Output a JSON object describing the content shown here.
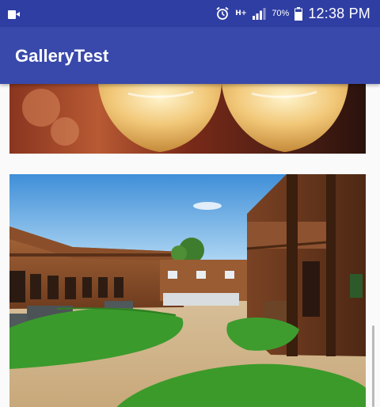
{
  "status_bar": {
    "left_icon": "video-camera-icon",
    "alarm_icon": "alarm-clock-icon",
    "network_label": "H+",
    "signal_icon": "cell-signal-icon",
    "battery_percent": "70%",
    "battery_icon": "battery-charging-icon",
    "time": "12:38 PM"
  },
  "app_bar": {
    "title": "GalleryTest",
    "color": "#3949ab"
  },
  "gallery": {
    "items": [
      {
        "subject": "wine glasses close-up photo"
      },
      {
        "subject": "wooden lodge courtyard with lawn photo"
      }
    ]
  },
  "colors": {
    "status_bar": "#2f3ea3",
    "app_bar": "#3949ab",
    "background": "#fafafa"
  }
}
